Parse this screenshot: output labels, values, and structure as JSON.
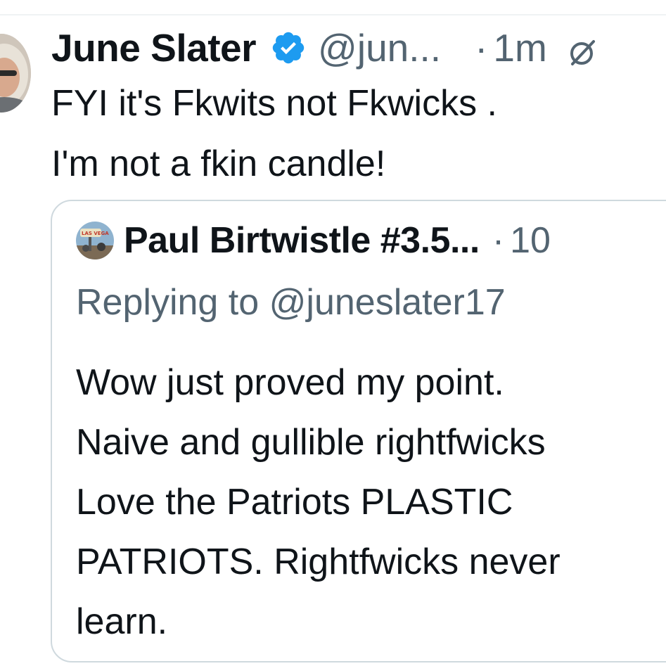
{
  "tweet": {
    "author_name": "June Slater",
    "handle": "@jun...",
    "separator": "·",
    "time": "1m",
    "verified": true,
    "avatar_icon": "profile-photo",
    "text_lines": [
      "FYI it's Fkwits not Fkwicks .",
      "I'm not a fkin candle!"
    ]
  },
  "quoted_tweet": {
    "author_name": "Paul Birtwistle #3.5...",
    "separator": "·",
    "time": "10",
    "avatar_icon": "las-vegas-sign-photo",
    "avatar_text": "LAS VEGA",
    "replying_to": "Replying to @juneslater17",
    "text_lines": [
      "Wow just proved my point.",
      "Naive and gullible rightfwicks",
      "Love the Patriots PLASTIC",
      "PATRIOTS. Rightfwicks never",
      "learn."
    ]
  },
  "colors": {
    "text_primary": "#0f1419",
    "text_secondary": "#536471",
    "verified_blue": "#1d9bf0",
    "card_border": "#cfd9de"
  }
}
